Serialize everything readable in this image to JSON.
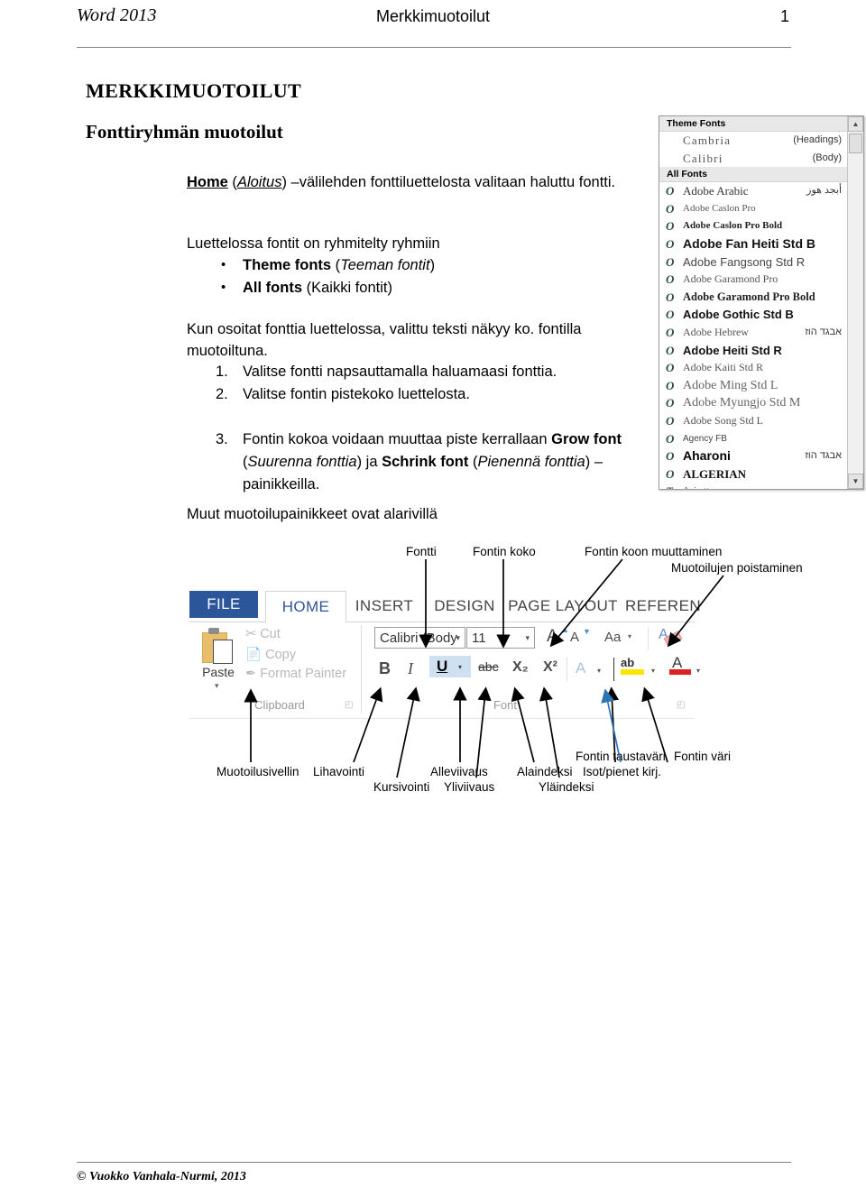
{
  "header": {
    "left": "Word 2013",
    "center": "Merkkimuotoilut",
    "page_number": "1"
  },
  "headings": {
    "h1": "MERKKIMUOTOILUT",
    "h2": "Fonttiryhmän muotoilut"
  },
  "body": {
    "p1_bold": "Home",
    "p1_paren_open": " (",
    "p1_italic": "Aloitus",
    "p1_rest": ") –välilehden fonttiluettelosta valitaan haluttu fontti.",
    "p2": "Luettelossa fontit on ryhmitelty ryhmiin",
    "bullets": [
      {
        "bold": "Theme fonts",
        "italic": "Teeman fontit"
      },
      {
        "bold": "All fonts",
        "plain": "Kaikki fontit"
      }
    ],
    "p3": "Kun osoitat fonttia luettelossa, valittu teksti näkyy ko. fontilla muotoiltuna.",
    "list": [
      {
        "num": "1.",
        "text": "Valitse fontti napsauttamalla haluamaasi fonttia."
      },
      {
        "num": "2.",
        "text": "Valitse fontin pistekoko luettelosta."
      }
    ],
    "item3": {
      "num": "3.",
      "t1": "Fontin kokoa voidaan muuttaa piste kerrallaan ",
      "b1": "Grow font",
      "t2": " (",
      "i1": "Suurenna fonttia",
      "t3": ") ja ",
      "b2": "Schrink font",
      "t4": " (",
      "i2": "Pienennä fonttia",
      "t5": ") – painikkeilla."
    },
    "p4": "Muut muotoilupainikkeet ovat alarivillä"
  },
  "font_dropdown": {
    "theme_group_label": "Theme Fonts",
    "all_group_label": "All Fonts",
    "theme_fonts": [
      {
        "name": "Cambria",
        "right": "(Headings)"
      },
      {
        "name": "Calibri",
        "right": "(Body)"
      }
    ],
    "all_fonts": [
      {
        "name": "Adobe Arabic",
        "right": "أبجد هوز",
        "icon": "opentype-icon"
      },
      {
        "name": "Adobe Caslon Pro",
        "right": "",
        "icon": "opentype-icon"
      },
      {
        "name": "Adobe Caslon Pro Bold",
        "right": "",
        "icon": "opentype-icon"
      },
      {
        "name": "Adobe Fan Heiti Std B",
        "right": "",
        "icon": "opentype-icon"
      },
      {
        "name": "Adobe Fangsong Std R",
        "right": "",
        "icon": "opentype-icon"
      },
      {
        "name": "Adobe Garamond Pro",
        "right": "",
        "icon": "opentype-icon"
      },
      {
        "name": "Adobe Garamond Pro Bold",
        "right": "",
        "icon": "opentype-icon"
      },
      {
        "name": "Adobe Gothic Std B",
        "right": "",
        "icon": "opentype-icon"
      },
      {
        "name": "Adobe Hebrew",
        "right": "אבגד הוז",
        "icon": "opentype-icon"
      },
      {
        "name": "Adobe Heiti Std R",
        "right": "",
        "icon": "opentype-icon"
      },
      {
        "name": "Adobe Kaiti Std R",
        "right": "",
        "icon": "opentype-icon"
      },
      {
        "name": "Adobe Ming Std L",
        "right": "",
        "icon": "opentype-icon"
      },
      {
        "name": "Adobe Myungjo Std M",
        "right": "",
        "icon": "opentype-icon"
      },
      {
        "name": "Adobe Song Std L",
        "right": "",
        "icon": "opentype-icon"
      },
      {
        "name": "Agency FB",
        "right": "",
        "icon": "opentype-icon"
      },
      {
        "name": "Aharoni",
        "right": "אבגד הוז",
        "icon": "opentype-icon"
      },
      {
        "name": "ALGERIAN",
        "right": "",
        "icon": "opentype-icon"
      },
      {
        "name": "Anisette",
        "right": "",
        "icon": "truetype-icon"
      }
    ],
    "scroll_up": "▲",
    "scroll_down": "▼"
  },
  "ribbon": {
    "tabs": [
      {
        "label": "FILE",
        "name": "tab-file"
      },
      {
        "label": "HOME",
        "name": "tab-home"
      },
      {
        "label": "INSERT",
        "name": "tab-insert"
      },
      {
        "label": "DESIGN",
        "name": "tab-design"
      },
      {
        "label": "PAGE LAYOUT",
        "name": "tab-page-layout"
      },
      {
        "label": "REFEREN",
        "name": "tab-references"
      }
    ],
    "clipboard": {
      "group_label": "Clipboard",
      "paste": "Paste",
      "cut": "Cut",
      "copy": "Copy",
      "format_painter": "Format Painter",
      "launcher": "◰"
    },
    "font": {
      "group_label": "Font",
      "font_name_value": "Calibri (Body",
      "font_size_value": "11",
      "grow_font": "A",
      "shrink_font": "A",
      "change_case": "Aa",
      "clear_formatting": "A",
      "bold": "B",
      "italic": "I",
      "underline": "U",
      "strikethrough": "abc",
      "subscript": "X₂",
      "superscript": "X²",
      "text_effects": "A",
      "highlight": "ab",
      "font_color": "A",
      "caret": "▾",
      "launcher": "◰"
    },
    "colors": {
      "file_tab_bg": "#2B579A",
      "home_tab_text": "#2B579A",
      "highlight_yellow": "#FFE400",
      "font_color_red": "#E02020",
      "paste_orange": "#E8BD6C",
      "underline_selected_bg": "#CFE0F2"
    }
  },
  "callouts": {
    "top": [
      {
        "label": "Fontti",
        "name": "callout-fontti"
      },
      {
        "label": "Fontin koko",
        "name": "callout-fontin-koko"
      },
      {
        "label": "Fontin koon muuttaminen",
        "name": "callout-fontin-koon-muuttaminen"
      },
      {
        "label": "Muotoilujen poistaminen",
        "name": "callout-muotoilujen-poistaminen"
      }
    ],
    "bottom": [
      {
        "label": "Muotoilusivellin",
        "name": "callout-muotoilusivellin"
      },
      {
        "label": "Lihavointi",
        "name": "callout-lihavointi"
      },
      {
        "label": "Kursivointi",
        "name": "callout-kursivointi"
      },
      {
        "label": "Alleviivaus",
        "name": "callout-alleviivaus"
      },
      {
        "label": "Yliviivaus",
        "name": "callout-yliviivaus"
      },
      {
        "label": "Alaindeksi",
        "name": "callout-alaindeksi"
      },
      {
        "label": "Yläindeksi",
        "name": "callout-ylaindeksi"
      },
      {
        "label": "Fontin taustaväri",
        "name": "callout-fontin-taustavari"
      },
      {
        "label": "Isot/pienet kirj.",
        "name": "callout-isot-pienet-kirj"
      },
      {
        "label": "Fontin väri",
        "name": "callout-fontin-vari"
      }
    ]
  },
  "footer": {
    "text": "© Vuokko Vanhala-Nurmi, 2013"
  }
}
